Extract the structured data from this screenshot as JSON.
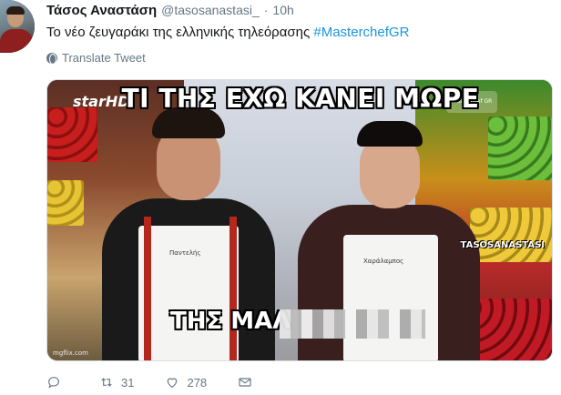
{
  "user": {
    "name": "Τάσος Αναστάση",
    "handle": "@tasosanastasi_",
    "separator": "·",
    "time": "10h"
  },
  "tweet": {
    "text": "Το νέο ζευγαράκι της ελληνικής τηλεόρασης ",
    "hashtag": "#MasterchefGR"
  },
  "translate_label": "Translate Tweet",
  "media": {
    "caption_top": "ΤΙ ΤΗΣ ΕΧΩ ΚΑΝΕΙ ΜΩΡΕ",
    "caption_bottom": "ΤΗΣ ΜΑΛ",
    "logo": "starHD",
    "watermark": "TASOSANASTASI",
    "corner_badge": "masterchef GR",
    "bottom_tag": "mgflix.com",
    "badge_left": "Παντελής",
    "badge_right": "Χαράλαμπος"
  },
  "actions": {
    "reply_count": "",
    "retweet_count": "31",
    "like_count": "278",
    "message_count": ""
  }
}
